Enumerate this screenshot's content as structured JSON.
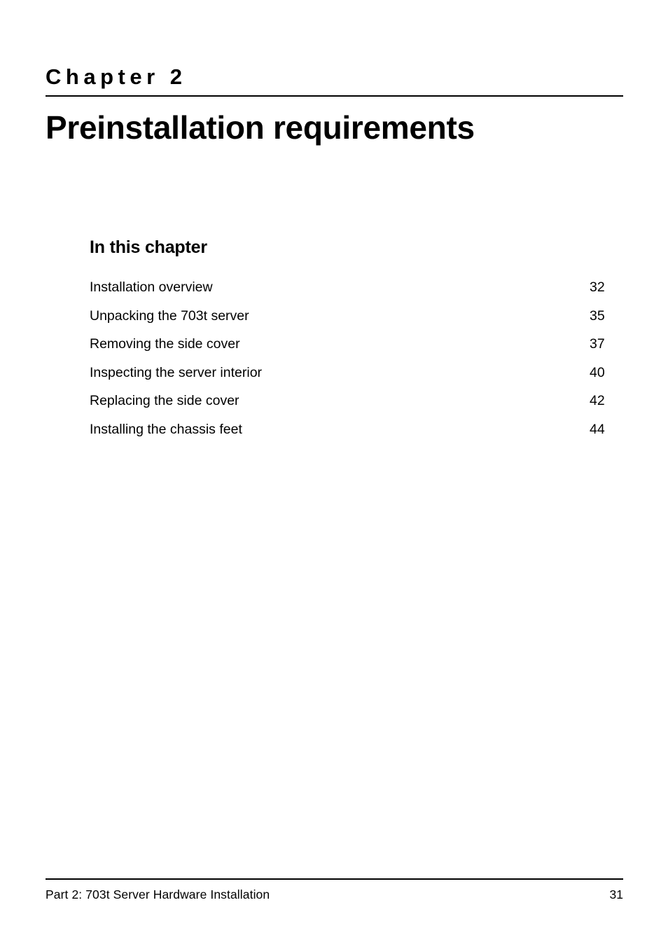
{
  "document": {
    "type": "printed-manual-page",
    "background_color": "#ffffff",
    "text_color": "#000000"
  },
  "chapter": {
    "eyebrow": "Chapter 2",
    "title": "Preinstallation requirements"
  },
  "toc": {
    "heading": "In this chapter",
    "entries": [
      {
        "label": "Installation overview",
        "page": "32"
      },
      {
        "label": "Unpacking the 703t server",
        "page": "35"
      },
      {
        "label": "Removing the side cover",
        "page": "37"
      },
      {
        "label": "Inspecting the server interior",
        "page": "40"
      },
      {
        "label": "Replacing the side cover",
        "page": "42"
      },
      {
        "label": "Installing the chassis feet",
        "page": "44"
      }
    ]
  },
  "footer": {
    "text": "Part 2: 703t Server Hardware Installation",
    "page_number": "31"
  }
}
